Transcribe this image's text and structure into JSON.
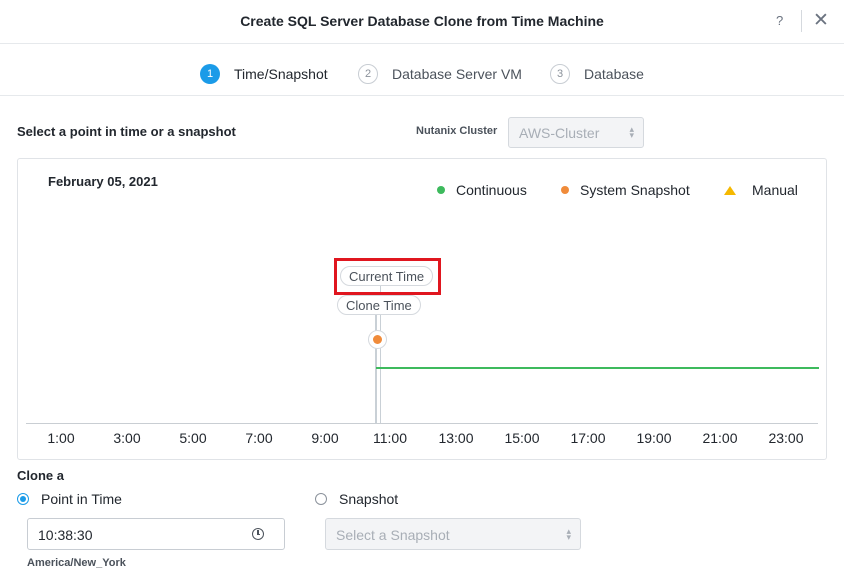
{
  "dialog": {
    "title": "Create SQL Server Database Clone from Time Machine",
    "help_label": "?",
    "close_label": "✕"
  },
  "steps": [
    {
      "num": "1",
      "label": "Time/Snapshot",
      "active": true
    },
    {
      "num": "2",
      "label": "Database Server VM",
      "active": false
    },
    {
      "num": "3",
      "label": "Database",
      "active": false
    }
  ],
  "selection": {
    "heading": "Select a point in time or a snapshot",
    "cluster_label": "Nutanix Cluster",
    "cluster_value": "AWS-Cluster",
    "cluster_caret": "▴▾"
  },
  "timeline": {
    "date": "February 05, 2021",
    "legend": {
      "continuous": "Continuous",
      "system_snapshot": "System Snapshot",
      "manual": "Manual"
    },
    "current_time_label": "Current Time",
    "clone_time_label": "Clone Time",
    "ticks": [
      "1:00",
      "3:00",
      "5:00",
      "7:00",
      "9:00",
      "11:00",
      "13:00",
      "15:00",
      "17:00",
      "19:00",
      "21:00",
      "23:00"
    ],
    "colors": {
      "continuous": "#3dba5d",
      "system_snapshot": "#f08b3a",
      "manual": "#f5b800",
      "highlight": "#e0161f"
    }
  },
  "clone": {
    "label": "Clone a",
    "point_in_time_label": "Point in Time",
    "snapshot_label": "Snapshot",
    "selected": "point_in_time",
    "time_value": "10:38:30",
    "timezone": "America/New_York",
    "snapshot_placeholder": "Select a Snapshot",
    "snapshot_caret": "▴▾"
  }
}
